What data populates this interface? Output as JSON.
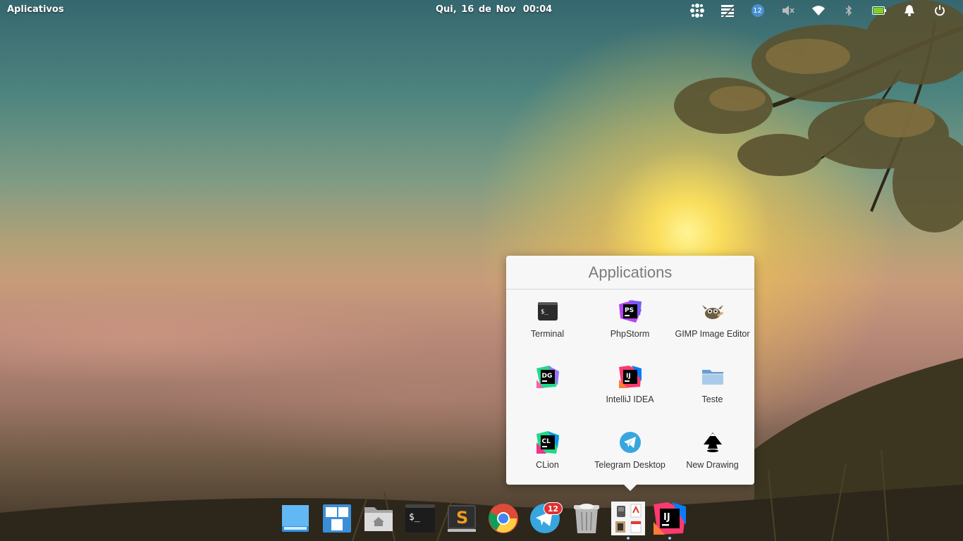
{
  "top_panel": {
    "applications_label": "Aplicativos",
    "date": "Qui, 16 de Nov",
    "time": "00:04",
    "notification_count": "12",
    "indicators": [
      "apps-grid-icon",
      "workspaces-icon",
      "telegram-notification-icon",
      "volume-muted-icon",
      "wifi-icon",
      "bluetooth-icon",
      "battery-icon",
      "notifications-bell-icon",
      "power-icon"
    ]
  },
  "popover": {
    "title": "Applications",
    "apps": [
      {
        "label": "Terminal",
        "icon": "terminal-icon"
      },
      {
        "label": "PhpStorm",
        "icon": "phpstorm-icon"
      },
      {
        "label": "GIMP Image Editor",
        "icon": "gimp-icon"
      },
      {
        "label": "",
        "icon": "datagrip-icon"
      },
      {
        "label": "IntelliJ IDEA",
        "icon": "intellij-icon"
      },
      {
        "label": "Teste",
        "icon": "folder-icon"
      },
      {
        "label": "CLion",
        "icon": "clion-icon"
      },
      {
        "label": "Telegram Desktop",
        "icon": "telegram-icon"
      },
      {
        "label": "New Drawing",
        "icon": "inkscape-icon"
      }
    ]
  },
  "dock": {
    "items": [
      "multitasking-view-icon",
      "workspace-switcher-icon",
      "home-folder-icon",
      "terminal-icon",
      "sublime-text-icon",
      "chrome-icon",
      "telegram-icon",
      "trash-icon",
      "applications-stack-icon",
      "intellij-icon"
    ],
    "telegram_badge": "12"
  },
  "icon_text": {
    "terminal": "$_",
    "phpstorm": "PS",
    "datagrip": "DG",
    "intellij": "IJ",
    "clion": "CL",
    "sublime": "S"
  },
  "colors": {
    "accent_blue": "#4a8fcf",
    "badge_red": "#e03030",
    "popover_bg": "#f7f7f7"
  }
}
